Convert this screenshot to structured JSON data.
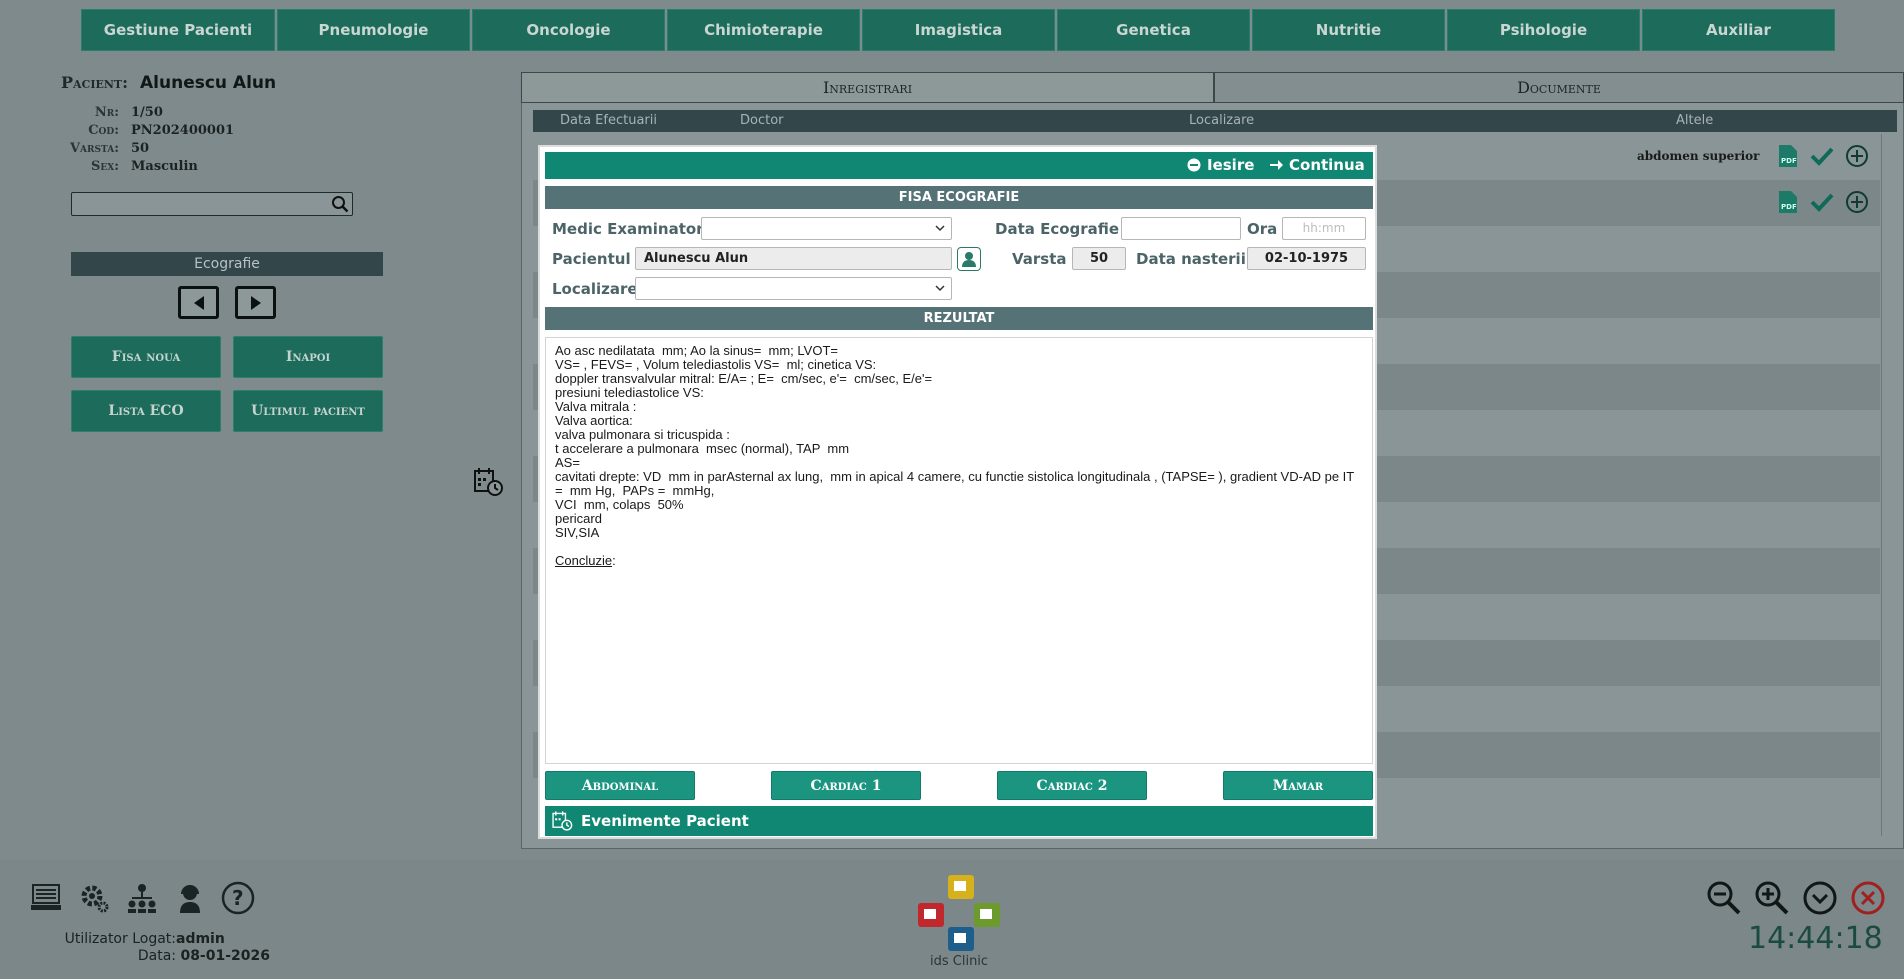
{
  "nav": [
    "Gestiune Pacienti",
    "Pneumologie",
    "Oncologie",
    "Chimioterapie",
    "Imagistica",
    "Genetica",
    "Nutritie",
    "Psihologie",
    "Auxiliar"
  ],
  "patient": {
    "label": "Pacient:",
    "name": "Alunescu Alun",
    "rows": [
      {
        "k": "Nr:",
        "v": "1/50"
      },
      {
        "k": "Cod:",
        "v": "PN202400001"
      },
      {
        "k": "Varsta:",
        "v": "50"
      },
      {
        "k": "Sex:",
        "v": "Masculin"
      }
    ]
  },
  "search": {
    "value": ""
  },
  "left": {
    "eco_label": "Ecografie",
    "fisa_noua": "Fisa noua",
    "inapoi": "Inapoi",
    "lista_eco": "Lista ECO",
    "ultimul_pacient": "Ultimul pacient"
  },
  "tabs": [
    "Inregistrari",
    "Documente"
  ],
  "table": {
    "headers": [
      "Data Efectuarii",
      "Doctor",
      "Localizare",
      "Altele"
    ],
    "row1_altele": "abdomen superior"
  },
  "modal": {
    "iesire": "Iesire",
    "continua": "Continua",
    "section1": "FISA ECOGRAFIE",
    "medic_label": "Medic Examinator",
    "medic_value": "",
    "data_eco_label": "Data Ecografie",
    "data_eco_value": "",
    "ora_label": "Ora",
    "ora_placeholder": "hh:mm",
    "pacient_label": "Pacientul",
    "pacient_value": "Alunescu Alun",
    "varsta_label": "Varsta",
    "varsta_value": "50",
    "nastere_label": "Data nasterii",
    "nastere_value": "02-10-1975",
    "localizare_label": "Localizare",
    "localizare_value": "",
    "section2": "REZULTAT",
    "rezultat_text": "Ao asc nedilatata  mm; Ao la sinus=  mm; LVOT=\nVS= , FEVS= , Volum telediastolis VS=  ml; cinetica VS:\ndoppler transvalvular mitral: E/A= ; E=  cm/sec, e'=  cm/sec, E/e'=\npresiuni telediastolice VS:\nValva mitrala :\nValva aortica:\nvalva pulmonara si tricuspida :\nt accelerare a pulmonara  msec (normal), TAP  mm\nAS=\ncavitati drepte: VD  mm in parAsternal ax lung,  mm in apical 4 camere, cu functie sistolica longitudinala , (TAPSE= ), gradient VD-AD pe IT  =  mm Hg,  PAPs =  mmHg,\nVCI  mm, colaps  50%\npericard\nSIV,SIA\n",
    "concluzie": "Concluzie",
    "concluzie_suffix": ":",
    "btn_abdominal": "Abdominal",
    "btn_cardiac1": "Cardiac 1",
    "btn_cardiac2": "Cardiac 2",
    "btn_mamar": "Mamar",
    "evenimente": "Evenimente Pacient"
  },
  "footer": {
    "user_label": "Utilizator Logat:",
    "user": "admin",
    "date_label": "Data:",
    "date": "08-01-2026",
    "logo_text": "ids Clinic",
    "clock": "14:44:18"
  },
  "colors": {
    "primary": "#0f8772",
    "section": "#557277",
    "nav": "#1c6b5b"
  }
}
